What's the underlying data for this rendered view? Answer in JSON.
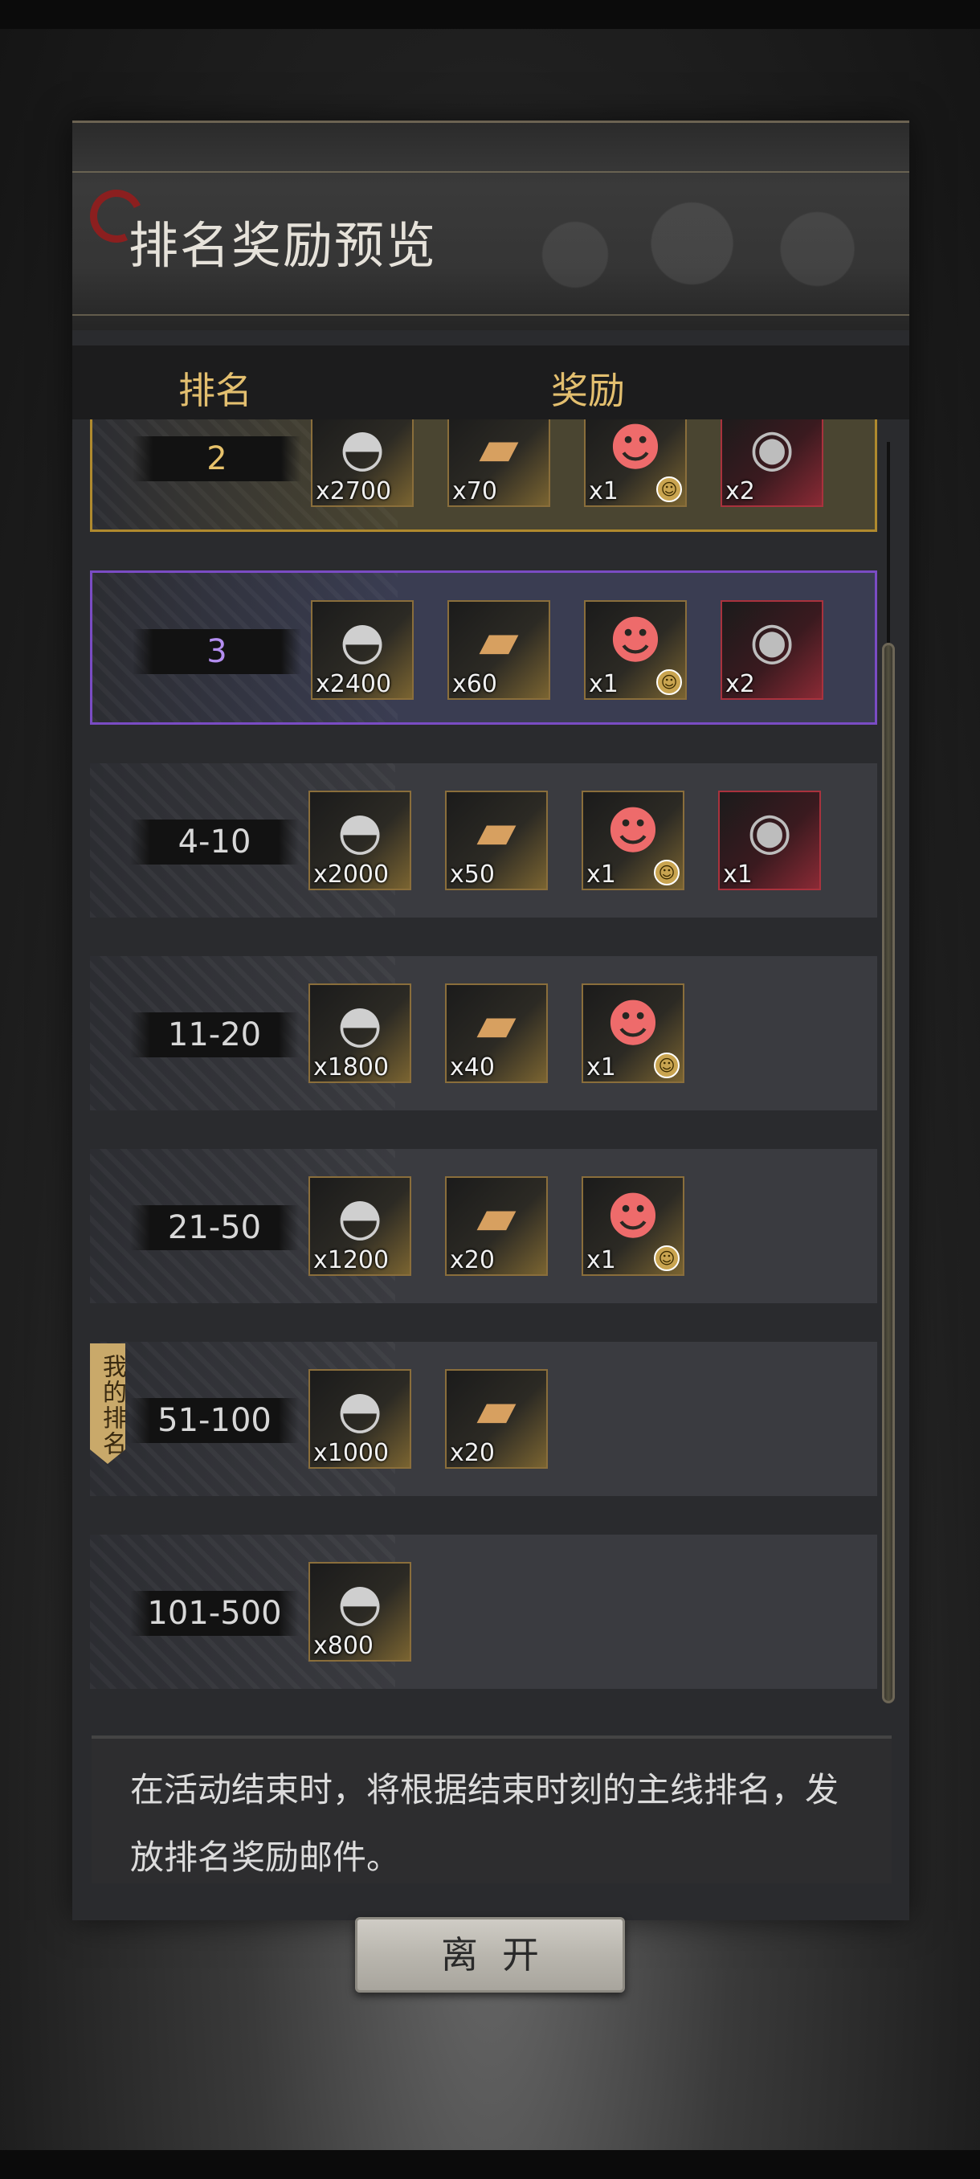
{
  "title": "排名奖励预览",
  "header": {
    "rank": "排名",
    "reward": "奖励"
  },
  "rows": [
    {
      "rank": "2",
      "tier": "gold",
      "rewards": [
        {
          "icon": "silver-ingot-icon",
          "qty": "x2700"
        },
        {
          "icon": "ticket-icon",
          "qty": "x70"
        },
        {
          "icon": "character-avatar-icon",
          "qty": "x1",
          "badge": true
        },
        {
          "icon": "portrait-coin-icon",
          "qty": "x2",
          "red": true
        }
      ]
    },
    {
      "rank": "3",
      "tier": "purple",
      "rewards": [
        {
          "icon": "silver-ingot-icon",
          "qty": "x2400"
        },
        {
          "icon": "ticket-icon",
          "qty": "x60"
        },
        {
          "icon": "character-avatar-icon",
          "qty": "x1",
          "badge": true
        },
        {
          "icon": "portrait-coin-icon",
          "qty": "x2",
          "red": true
        }
      ]
    },
    {
      "rank": "4-10",
      "tier": "normal",
      "rewards": [
        {
          "icon": "silver-ingot-icon",
          "qty": "x2000"
        },
        {
          "icon": "ticket-icon",
          "qty": "x50"
        },
        {
          "icon": "character-avatar-icon",
          "qty": "x1",
          "badge": true
        },
        {
          "icon": "portrait-coin-icon",
          "qty": "x1",
          "red": true
        }
      ]
    },
    {
      "rank": "11-20",
      "tier": "normal",
      "rewards": [
        {
          "icon": "silver-ingot-icon",
          "qty": "x1800"
        },
        {
          "icon": "ticket-icon",
          "qty": "x40"
        },
        {
          "icon": "character-avatar-icon",
          "qty": "x1",
          "badge": true
        }
      ]
    },
    {
      "rank": "21-50",
      "tier": "normal",
      "rewards": [
        {
          "icon": "silver-ingot-icon",
          "qty": "x1200"
        },
        {
          "icon": "ticket-icon",
          "qty": "x20"
        },
        {
          "icon": "character-avatar-icon",
          "qty": "x1",
          "badge": true
        }
      ]
    },
    {
      "rank": "51-100",
      "tier": "normal",
      "rewards": [
        {
          "icon": "silver-ingot-icon",
          "qty": "x1000"
        },
        {
          "icon": "ticket-icon",
          "qty": "x20"
        }
      ]
    },
    {
      "rank": "101-500",
      "tier": "normal",
      "rewards": [
        {
          "icon": "silver-ingot-icon",
          "qty": "x800"
        }
      ]
    }
  ],
  "my_rank_label": "我的排名",
  "notice": "在活动结束时，将根据结束时刻的主线排名，发放排名奖励邮件。",
  "leave_button": "离开"
}
